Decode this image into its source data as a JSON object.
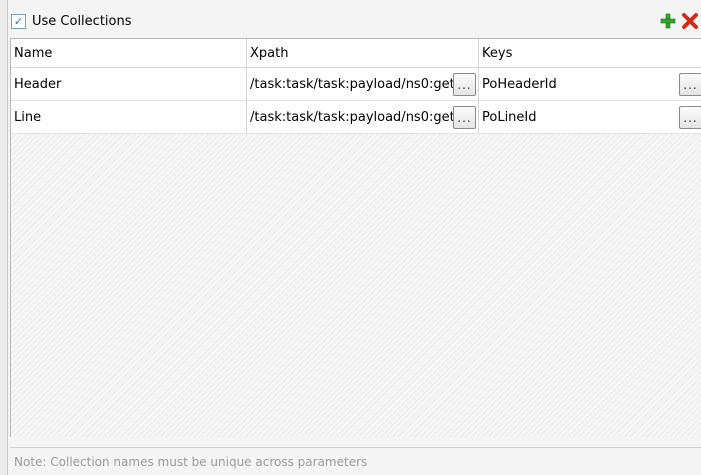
{
  "toolbar": {
    "checkbox_checked": true,
    "use_collections_label": "Use Collections",
    "add_icon": "plus-icon",
    "remove_icon": "delete-x-icon",
    "add_color": "#2ea62a",
    "remove_color": "#d42a1a"
  },
  "table": {
    "columns": [
      "Name",
      "Xpath",
      "Keys"
    ],
    "rows": [
      {
        "name": "Header",
        "xpath": "/task:task/task:payload/ns0:get",
        "keys": "PoHeaderId",
        "button": "..."
      },
      {
        "name": "Line",
        "xpath": "/task:task/task:payload/ns0:get",
        "keys": "PoLineId",
        "button": "..."
      }
    ]
  },
  "note": "Note: Collection names must be unique across parameters"
}
